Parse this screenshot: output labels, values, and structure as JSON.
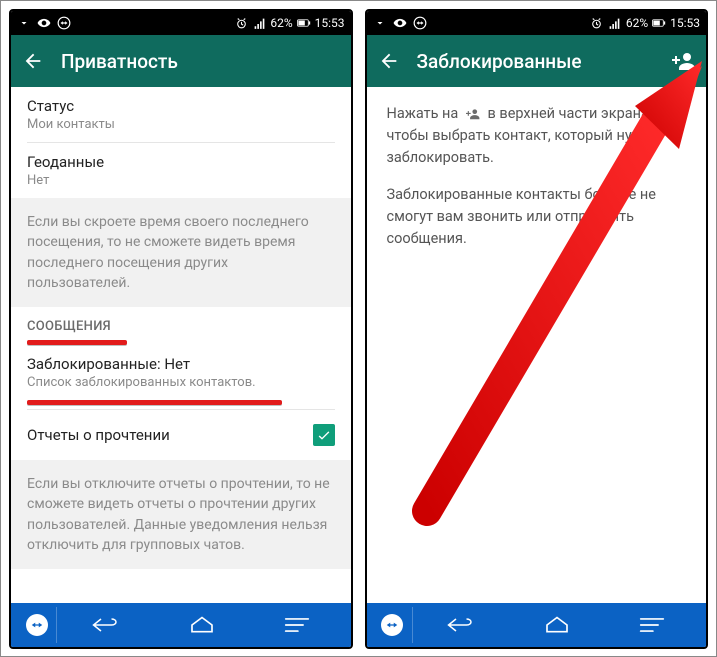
{
  "status": {
    "battery_pct": "62%",
    "time": "15:53"
  },
  "left": {
    "appbar_title": "Приватность",
    "status_label": "Статус",
    "status_value": "Мои контакты",
    "geo_label": "Геоданные",
    "geo_value": "Нет",
    "info1": "Если вы скроете время своего последнего посещения, то не сможете видеть время последнего посещения других пользователей.",
    "section_messages": "СООБЩЕНИЯ",
    "blocked_label": "Заблокированные: Нет",
    "blocked_sub": "Список заблокированных контактов.",
    "read_receipts_label": "Отчеты о прочтении",
    "info2": "Если вы отключите отчеты о прочтении, то не сможете видеть отчеты о прочтении других пользователей. Данные уведомления нельзя отключить для групповых чатов."
  },
  "right": {
    "appbar_title": "Заблокированные",
    "body1a": "Нажать на ",
    "body1b": " в верхней части экрана, чтобы выбрать контакт, который нужно заблокировать.",
    "body2": "Заблокированные контакты больше не смогут вам звонить или отправлять сообщения."
  }
}
